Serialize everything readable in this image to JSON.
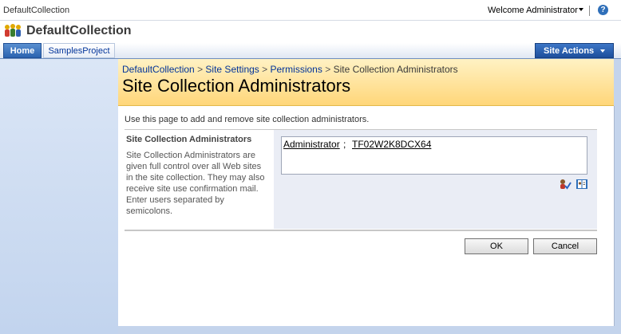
{
  "top": {
    "site_crumb": "DefaultCollection",
    "welcome": "Welcome Administrator",
    "help": "?"
  },
  "site": {
    "title": "DefaultCollection"
  },
  "nav": {
    "tabs": [
      {
        "label": "Home"
      },
      {
        "label": "SamplesProject"
      }
    ],
    "site_actions": "Site Actions"
  },
  "breadcrumb": {
    "items": [
      "DefaultCollection",
      "Site Settings",
      "Permissions",
      "Site Collection Administrators"
    ],
    "separator": ">"
  },
  "page": {
    "title": "Site Collection Administrators",
    "description": "Use this page to add and remove site collection administrators."
  },
  "section": {
    "heading": "Site Collection Administrators",
    "help": "Site Collection Administrators are given full control over all Web sites in the site collection. They may also receive site use confirmation mail. Enter users separated by semicolons."
  },
  "people_picker": {
    "entries": [
      "Administrator",
      "TF02W2K8DCX64"
    ],
    "separator": ";"
  },
  "buttons": {
    "ok": "OK",
    "cancel": "Cancel"
  },
  "icons": {
    "help": "help-icon",
    "site_logo": "people-icon",
    "check_names": "check-names-icon",
    "browse": "address-book-icon"
  },
  "colors": {
    "accent": "#2b63b0",
    "header_gold": "#ffd679",
    "link": "#003399"
  }
}
